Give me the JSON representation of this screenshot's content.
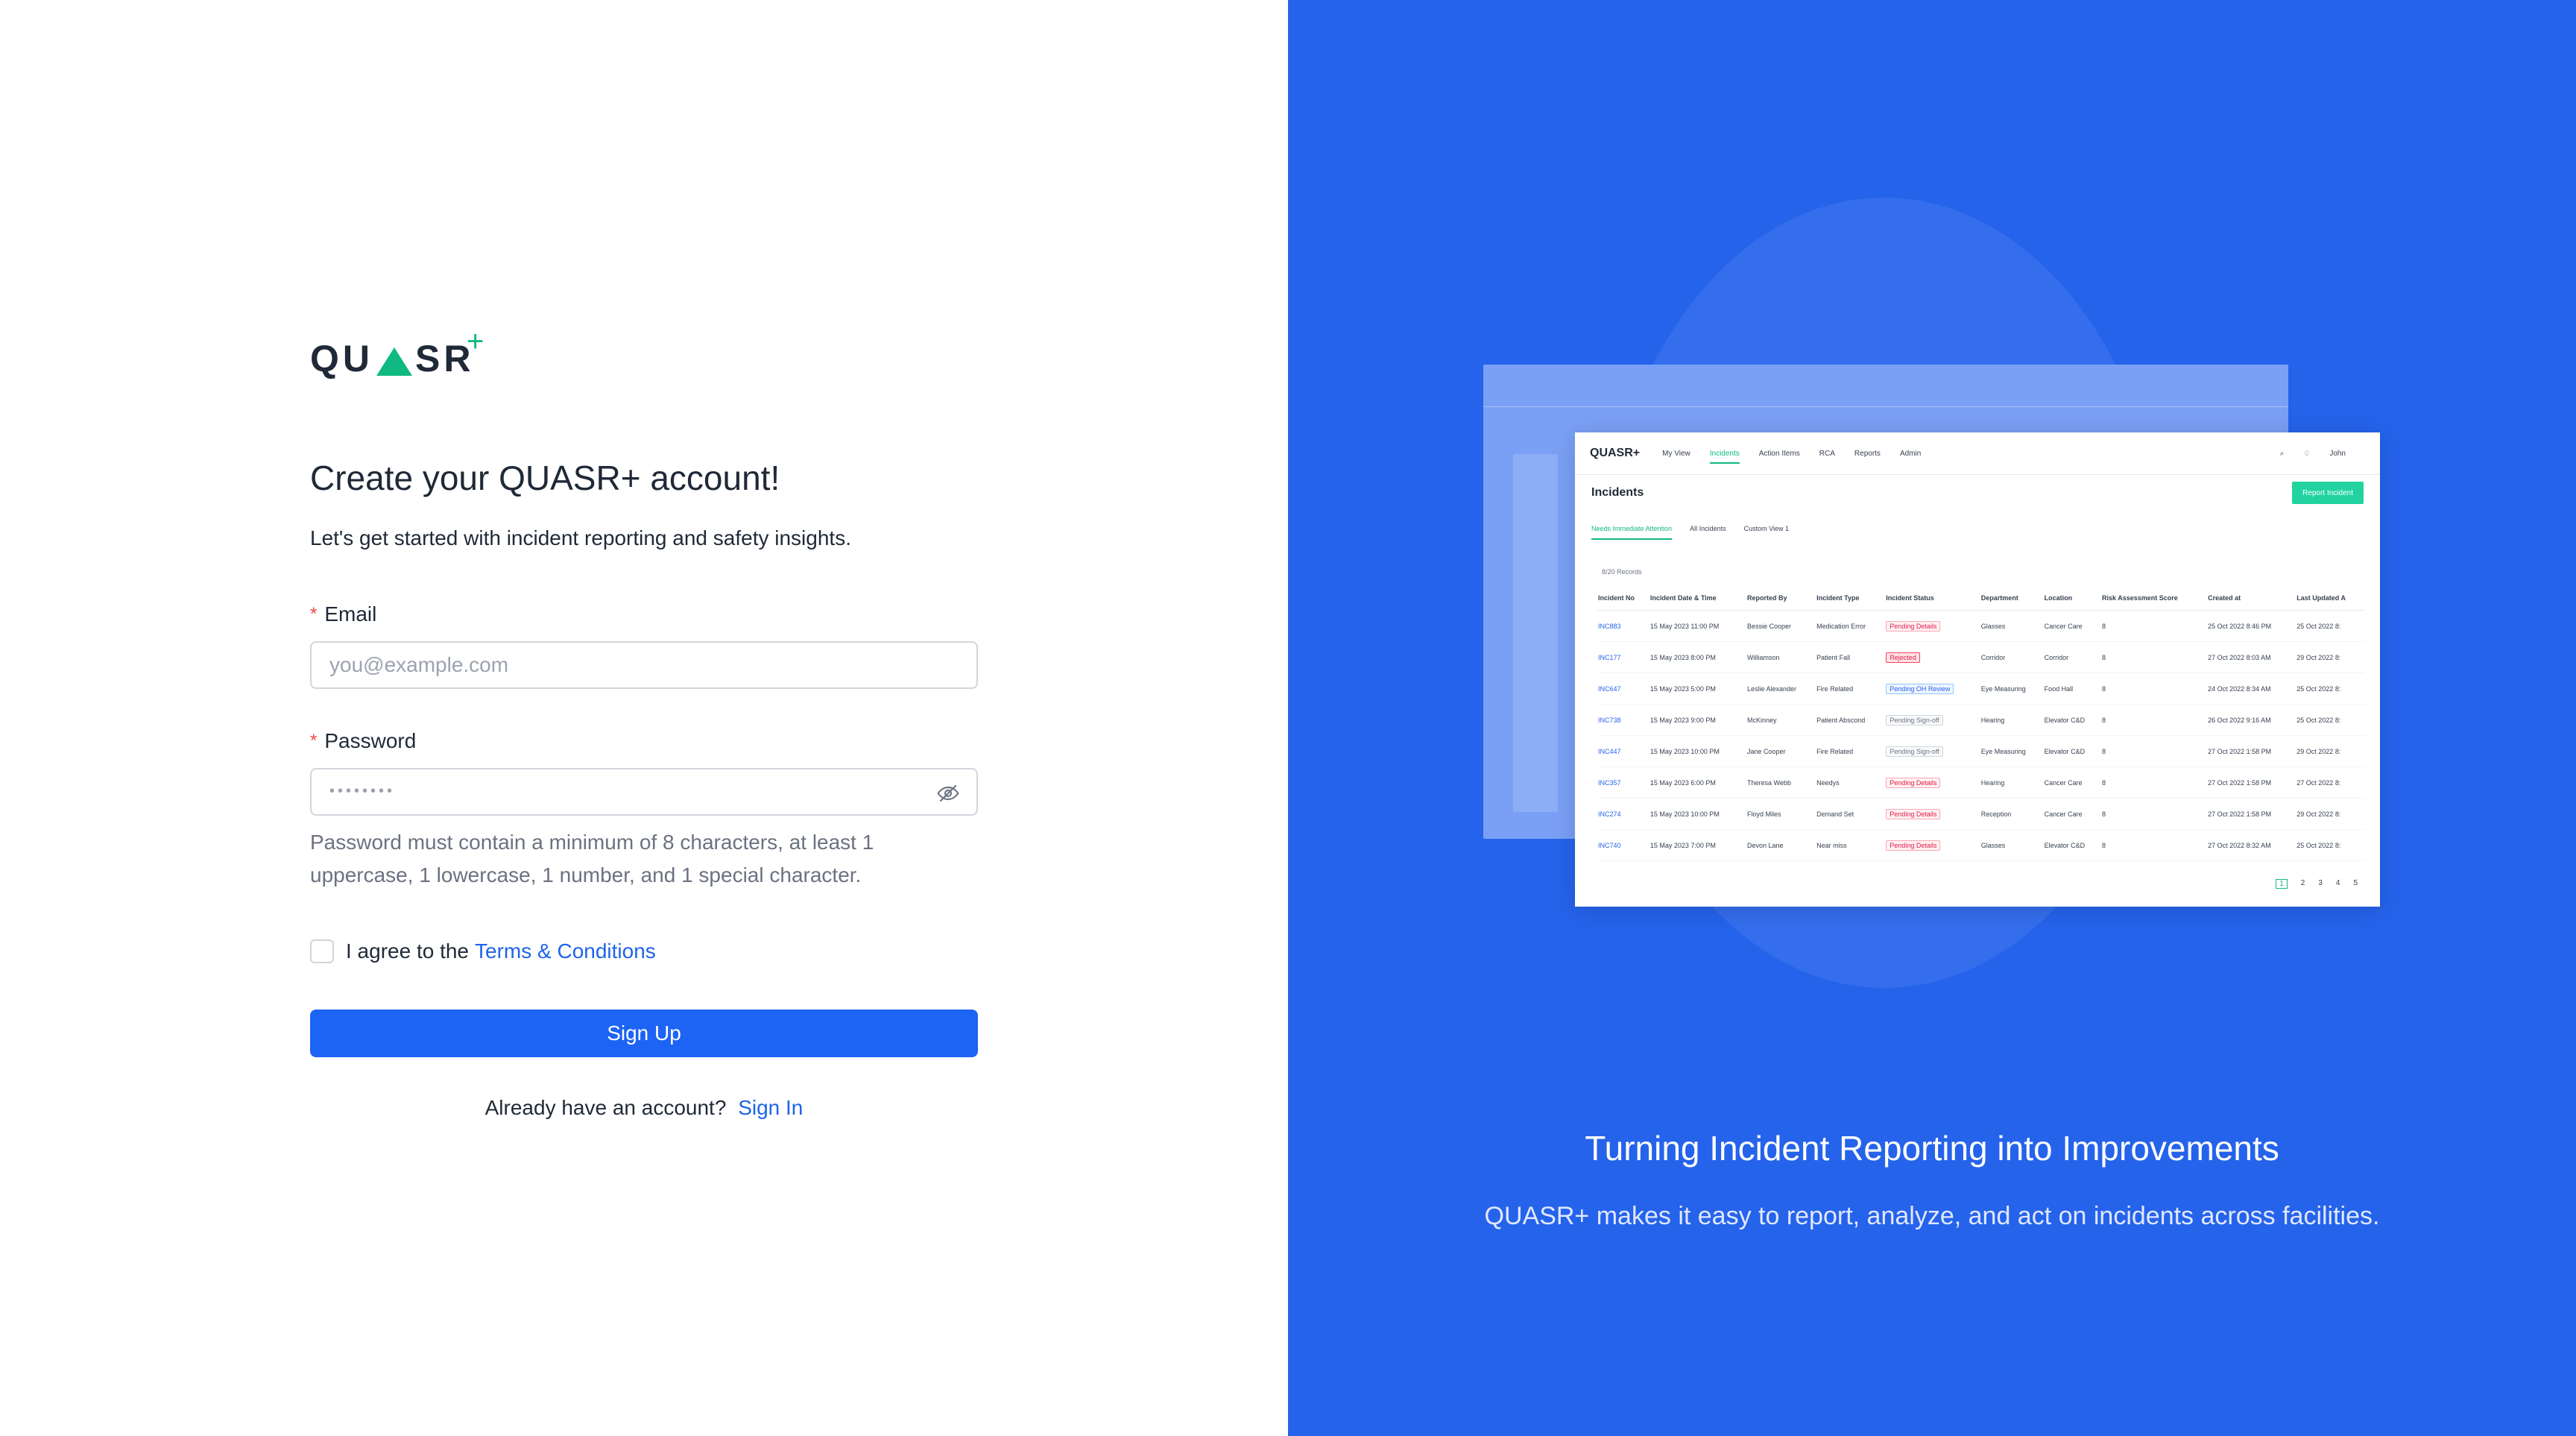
{
  "logo": {
    "text_left": "QU",
    "text_right": "SR",
    "plus": "+"
  },
  "form": {
    "title": "Create your QUASR+ account!",
    "subtitle": "Let's get started with incident reporting and safety insights.",
    "email_label": "Email",
    "email_placeholder": "you@example.com",
    "password_label": "Password",
    "password_dots": "••••••••",
    "password_hint": "Password must contain a minimum of 8 characters, at least 1 uppercase, 1 lowercase, 1 number, and 1 special character.",
    "agree_text": "I agree to the",
    "terms_link": "Terms & Conditions",
    "signup_label": "Sign Up",
    "have_account": "Already have an account?",
    "signin_link": "Sign In",
    "required_mark": "*"
  },
  "preview": {
    "logo": "QUASR+",
    "nav": [
      "My View",
      "Incidents",
      "Action Items",
      "RCA",
      "Reports",
      "Admin"
    ],
    "user": "John",
    "title": "Incidents",
    "report_button": "Report Incident",
    "tabs": [
      "Needs Immediate Attention",
      "All Incidents",
      "Custom View 1"
    ],
    "records": "8/20 Records",
    "columns": [
      "Incident No",
      "Incident Date & Time",
      "Reported By",
      "Incident Type",
      "Incident Status",
      "Department",
      "Location",
      "Risk Assessment Score",
      "Created at",
      "Last Updated A"
    ],
    "rows": [
      [
        "INC883",
        "15 May 2023 11:00 PM",
        "Bessie Cooper",
        "Medication Error",
        "Pending Details",
        "Glasses",
        "Cancer Care",
        "8",
        "25 Oct 2022 8:46 PM",
        "25 Oct 2022 8:"
      ],
      [
        "INC177",
        "15 May 2023 8:00 PM",
        "Williamson",
        "Patient Fall",
        "Rejected",
        "Corridor",
        "Corridor",
        "8",
        "27 Oct 2022 8:03 AM",
        "29 Oct 2022 8:"
      ],
      [
        "INC647",
        "15 May 2023 5:00 PM",
        "Leslie Alexander",
        "Fire Related",
        "Pending OH Review",
        "Eye Measuring",
        "Food Hall",
        "8",
        "24 Oct 2022 8:34 AM",
        "25 Oct 2022 8:"
      ],
      [
        "INC738",
        "15 May 2023 9:00 PM",
        "McKinney",
        "Patient Abscond",
        "Pending Sign-off",
        "Hearing",
        "Elevator C&D",
        "8",
        "26 Oct 2022 9:16 AM",
        "25 Oct 2022 8:"
      ],
      [
        "INC447",
        "15 May 2023 10:00 PM",
        "Jane Cooper",
        "Fire Related",
        "Pending Sign-off",
        "Eye Measuring",
        "Elevator C&D",
        "8",
        "27 Oct 2022 1:58 PM",
        "29 Oct 2022 8:"
      ],
      [
        "INC357",
        "15 May 2023 6:00 PM",
        "Theresa Webb",
        "Needys",
        "Pending Details",
        "Hearing",
        "Cancer Care",
        "8",
        "27 Oct 2022 1:58 PM",
        "27 Oct 2022 8:"
      ],
      [
        "INC274",
        "15 May 2023 10:00 PM",
        "Floyd Miles",
        "Demand Set",
        "Pending Details",
        "Reception",
        "Cancer Care",
        "8",
        "27 Oct 2022 1:58 PM",
        "29 Oct 2022 8:"
      ],
      [
        "INC740",
        "15 May 2023 7:00 PM",
        "Devon Lane",
        "Near miss",
        "Pending Details",
        "Glasses",
        "Elevator C&D",
        "8",
        "27 Oct 2022 8:32 AM",
        "25 Oct 2022 8:"
      ]
    ],
    "pages": [
      "1",
      "2",
      "3",
      "4",
      "5"
    ]
  },
  "tagline": {
    "title": "Turning Incident Reporting into Improvements",
    "subtitle": "QUASR+ makes it easy to report, analyze, and act on incidents across facilities."
  },
  "colors": {
    "brand_blue": "#2563eb",
    "button_blue": "#1d64f5",
    "accent_green": "#10b981"
  }
}
